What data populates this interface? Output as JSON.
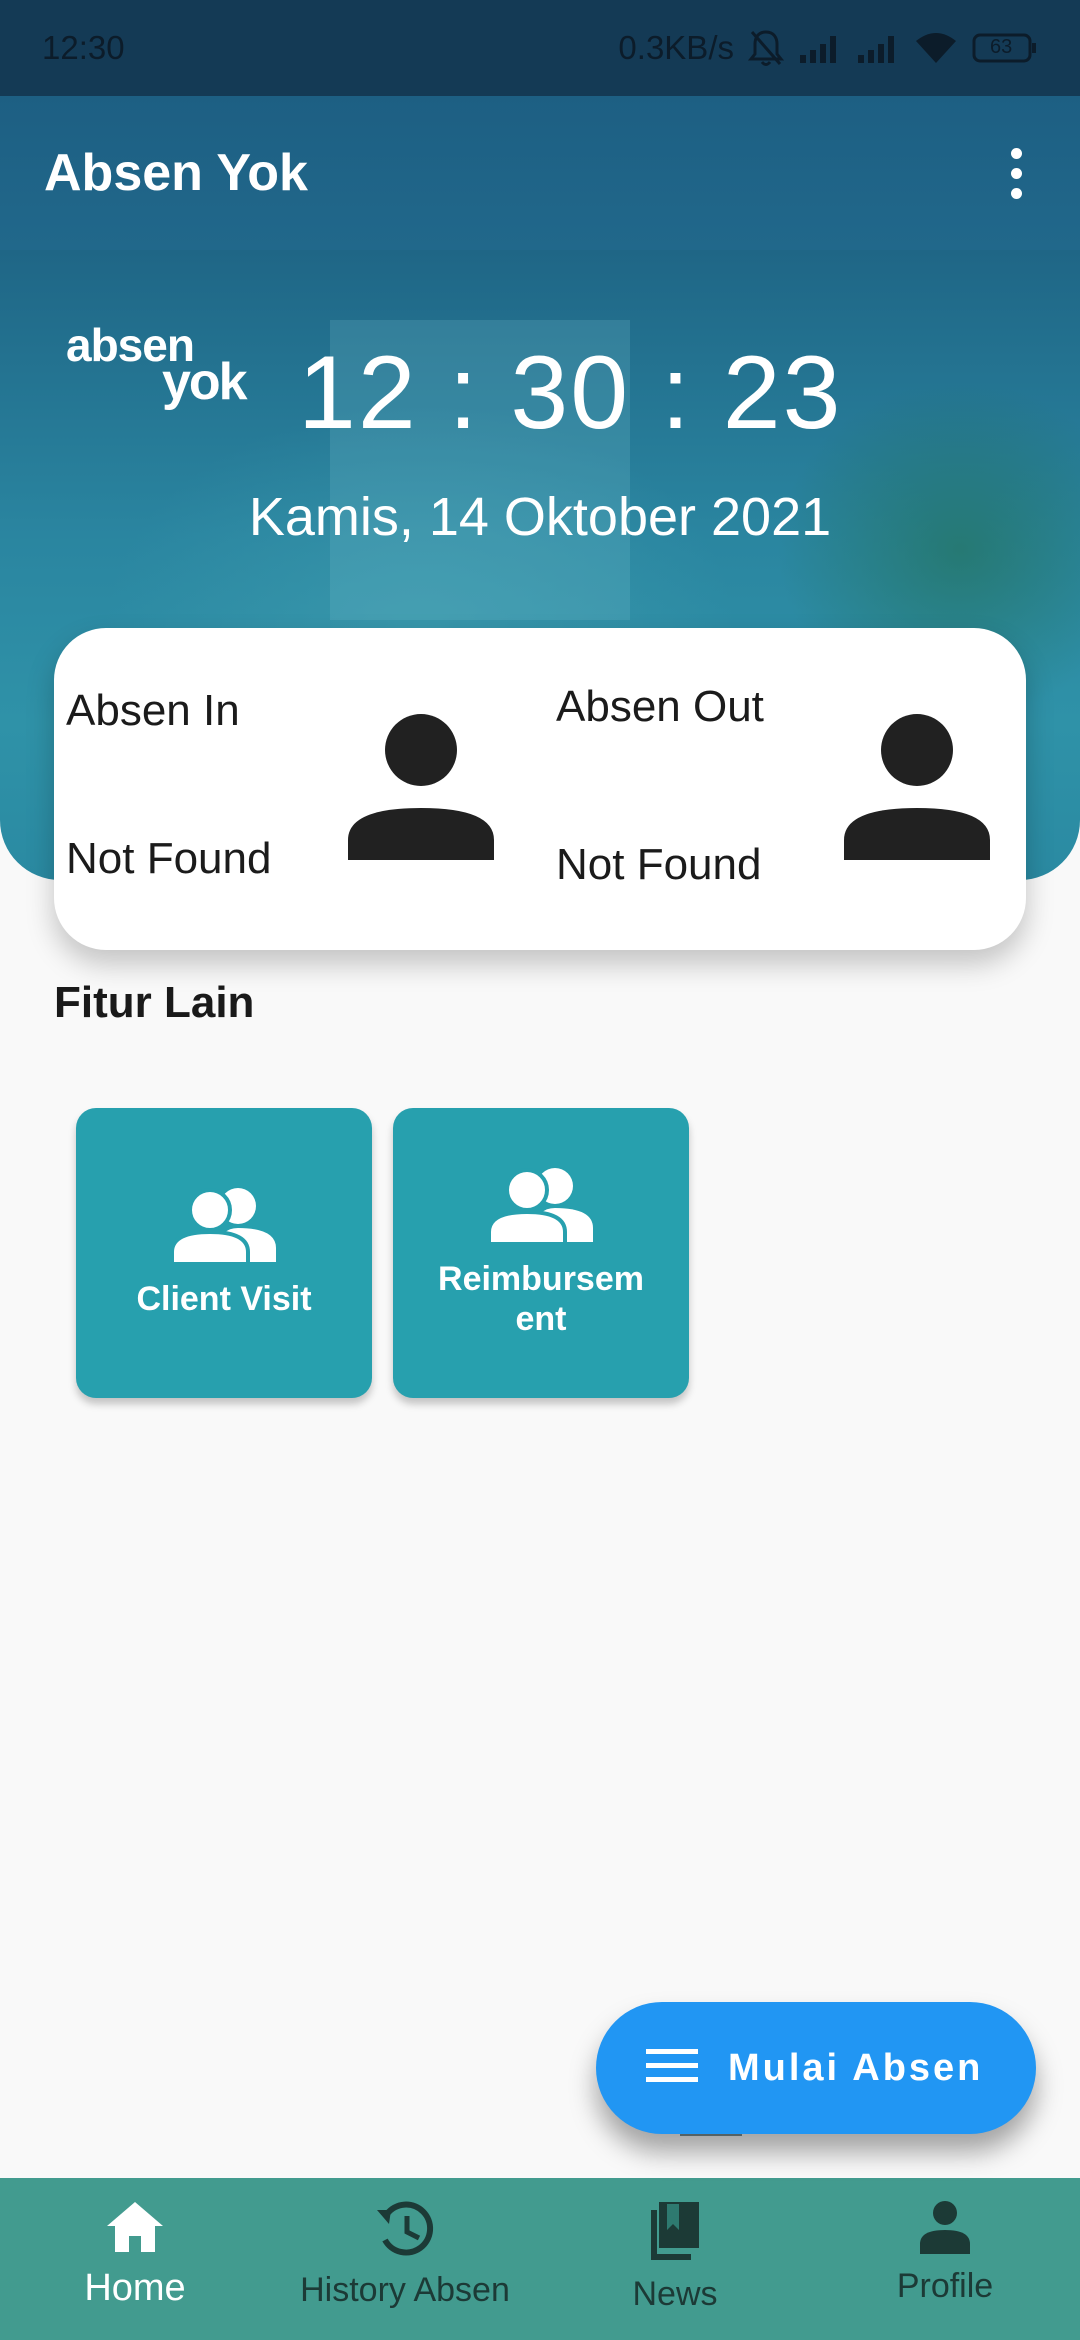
{
  "status_bar": {
    "time": "12:30",
    "net_speed": "0.3KB/s",
    "battery": "63",
    "icons": [
      "bell-off-icon",
      "signal-icon",
      "signal-icon",
      "wifi-icon",
      "battery-icon"
    ]
  },
  "app_bar": {
    "title": "Absen Yok",
    "menu_icon": "more-vert-icon"
  },
  "hero": {
    "logo_line1": "absen",
    "logo_line2": "yok",
    "clock": "12 : 30 : 23",
    "date": "Kamis, 14 Oktober 2021"
  },
  "attendance": {
    "in_label": "Absen In",
    "in_status": "Not Found",
    "out_label": "Absen Out",
    "out_status": "Not Found"
  },
  "features": {
    "title": "Fitur Lain",
    "items": [
      {
        "label": "Client Visit",
        "icon": "people-icon"
      },
      {
        "label": "Reimbursem\nent",
        "icon": "people-icon"
      }
    ]
  },
  "fab": {
    "label": "Mulai Absen",
    "icon": "menu-icon"
  },
  "bottom_nav": {
    "items": [
      {
        "label": "Home",
        "icon": "home-icon",
        "active": true
      },
      {
        "label": "History Absen",
        "icon": "history-icon",
        "active": false
      },
      {
        "label": "News",
        "icon": "book-icon",
        "active": false
      },
      {
        "label": "Profile",
        "icon": "person-icon",
        "active": false
      }
    ]
  },
  "colors": {
    "status_bar": "#143a55",
    "app_bar": "#1d5f83",
    "tile": "#27a0ae",
    "fab": "#2196f3",
    "bottom_nav": "#429b8f"
  }
}
